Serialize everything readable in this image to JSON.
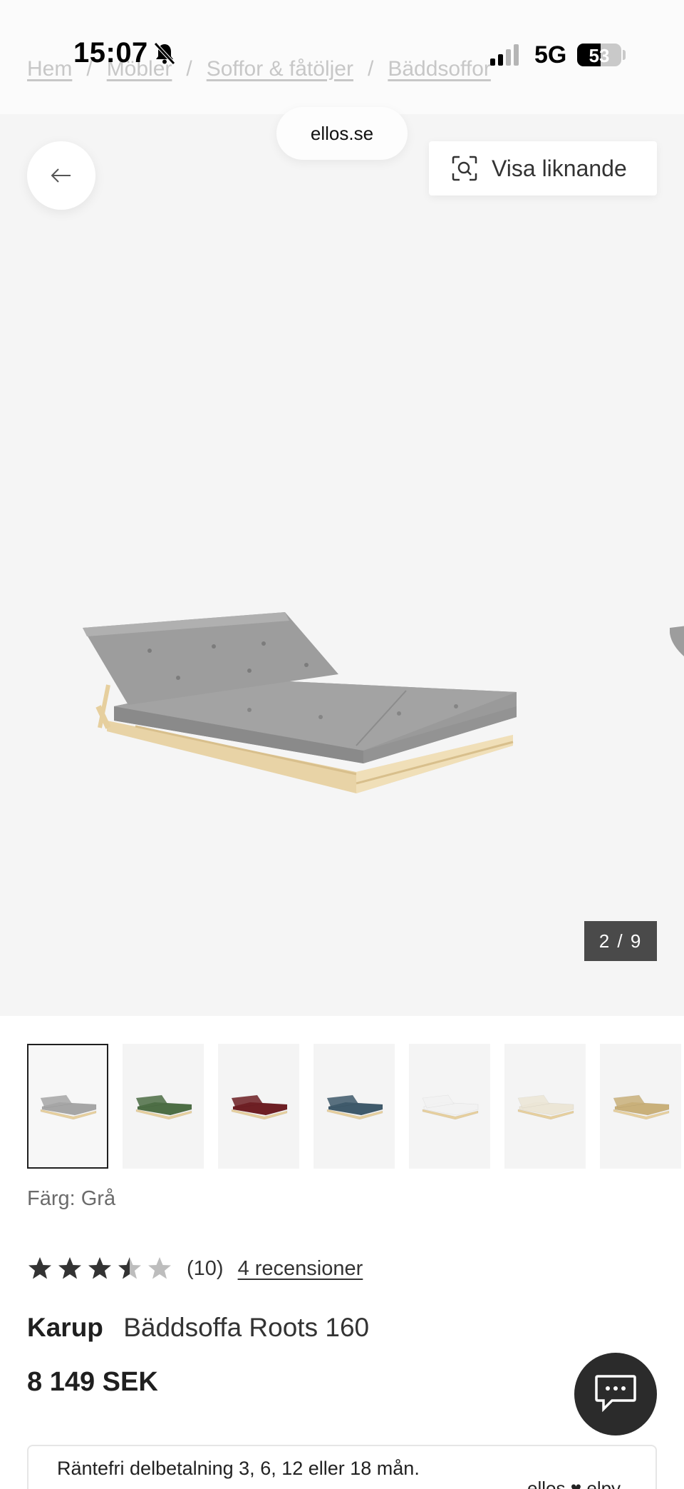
{
  "status_bar": {
    "time": "15:07",
    "network": "5G",
    "battery_level": "53",
    "battery_fraction": 0.53
  },
  "breadcrumb": [
    "Hem",
    "Möbler",
    "Soffor & fåtöljer",
    "Bäddsoffor"
  ],
  "browser": {
    "url": "ellos.se"
  },
  "gallery": {
    "similar_label": "Visa liknande",
    "counter": "2 / 9"
  },
  "thumbnails": [
    {
      "color": "#a6a6a6",
      "name": "Grå"
    },
    {
      "color": "#4d6e45",
      "name": "Grön"
    },
    {
      "color": "#6e1f24",
      "name": "Vinröd"
    },
    {
      "color": "#3f5a6b",
      "name": "Blå"
    },
    {
      "color": "#f2f2f2",
      "name": "Vit"
    },
    {
      "color": "#ece6d6",
      "name": "Natur"
    },
    {
      "color": "#c9b07a",
      "name": "Gul"
    }
  ],
  "product": {
    "color_label": "Färg: Grå",
    "rating": 3.5,
    "rating_count": "(10)",
    "reviews_link": "4 recensioner",
    "brand": "Karup",
    "name": "Bäddsoffa Roots 160",
    "price": "8 149 SEK"
  },
  "finance": {
    "text": "Räntefri delbetalning 3, 6, 12 eller 18 mån.",
    "logo": "ellos ♥ elpy"
  },
  "colors": {
    "accent_dark": "#1f1f1f",
    "gallery_bg": "#f5f5f5",
    "counter_bg": "#4a4a4a"
  }
}
